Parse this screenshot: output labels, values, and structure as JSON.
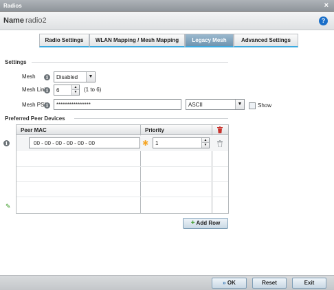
{
  "window": {
    "title": "Radios"
  },
  "header": {
    "name_label": "Name",
    "name_value": "radio2"
  },
  "tabs": [
    {
      "label": "Radio Settings",
      "active": false
    },
    {
      "label": "WLAN Mapping / Mesh Mapping",
      "active": false
    },
    {
      "label": "Legacy Mesh",
      "active": true
    },
    {
      "label": "Advanced Settings",
      "active": false
    }
  ],
  "settings": {
    "section_title": "Settings",
    "mesh": {
      "label": "Mesh",
      "value": "Disabled"
    },
    "mesh_links": {
      "label": "Mesh Links",
      "value": "6",
      "range": "(1 to 6)"
    },
    "mesh_psk": {
      "label": "Mesh PSK",
      "value": "****************",
      "format": "ASCII",
      "show_label": "Show",
      "show_checked": false
    }
  },
  "peers": {
    "section_title": "Preferred Peer Devices",
    "columns": [
      "Peer MAC",
      "Priority"
    ],
    "rows": [
      {
        "mac": "00 - 00 - 00 - 00 - 00 - 00",
        "priority": "1"
      }
    ],
    "add_row_label": "Add Row"
  },
  "footer": {
    "ok_label": "OK",
    "reset_label": "Reset",
    "exit_label": "Exit"
  },
  "colors": {
    "accent": "#39a9e0",
    "title_bar": "#8f959b",
    "active_tab": "#6f94af",
    "delete_icon": "#c8322c",
    "add_icon": "#3b9b26"
  }
}
